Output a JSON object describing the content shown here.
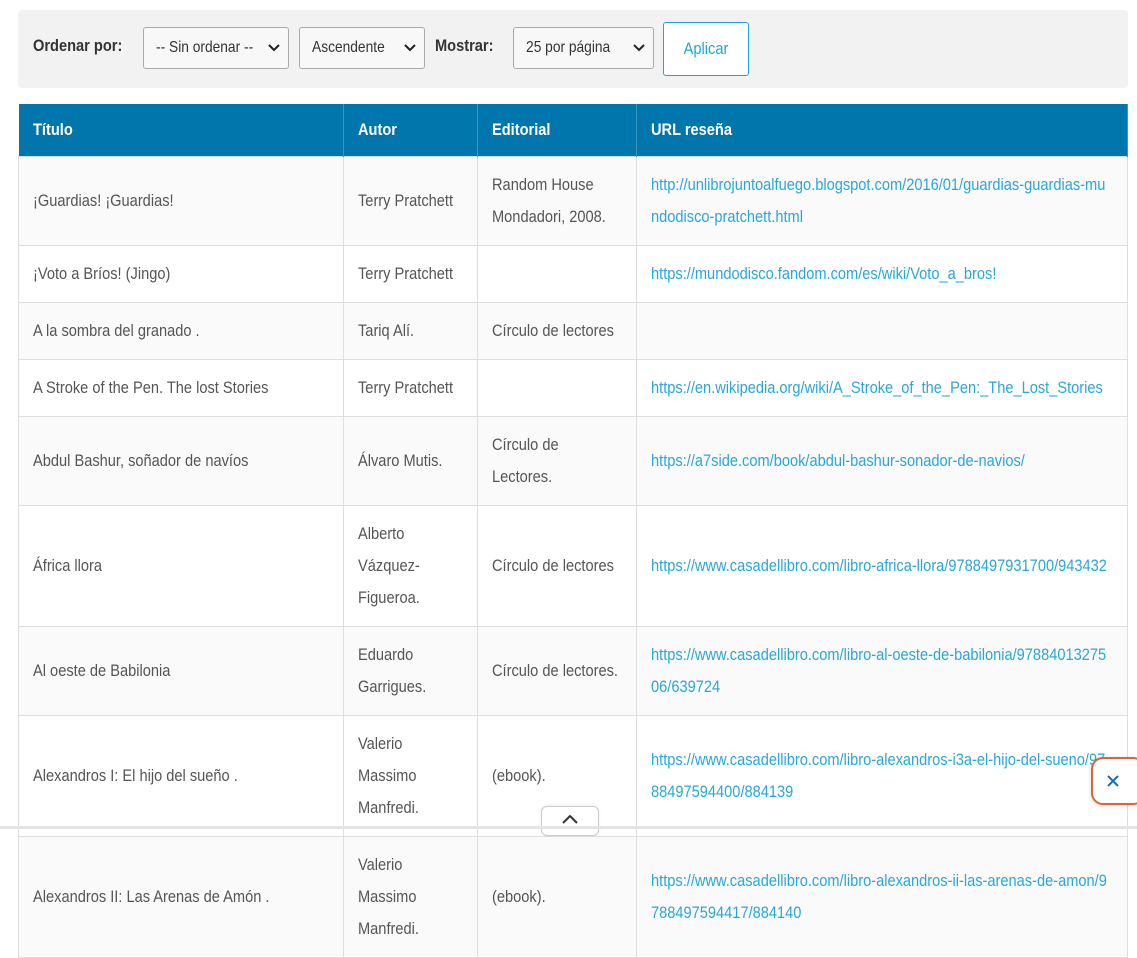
{
  "toolbar": {
    "sort_label": "Ordenar por:",
    "sort_value": "-- Sin ordenar --",
    "order_value": "Ascendente",
    "show_label": "Mostrar:",
    "show_value": "25 por página",
    "apply_label": "Aplicar"
  },
  "table": {
    "headers": [
      "Título",
      "Autor",
      "Editorial",
      "URL reseña"
    ],
    "rows": [
      {
        "titulo": "¡Guardias! ¡Guardias!",
        "autor": "Terry Pratchett",
        "editorial": "Random House Mondadori, 2008.",
        "url": "http://unlibrojuntoalfuego.blogspot.com/2016/01/guardias-guardias-mundodisco-pratchett.html"
      },
      {
        "titulo": "¡Voto a Bríos! (Jingo)",
        "autor": "Terry Pratchett",
        "editorial": "",
        "url": "https://mundodisco.fandom.com/es/wiki/Voto_a_bros!"
      },
      {
        "titulo": "A la sombra del granado .",
        "autor": "Tariq Alí.",
        "editorial": "Círculo de lectores",
        "url": ""
      },
      {
        "titulo": "A Stroke of the Pen. The lost Stories",
        "autor": "Terry Pratchett",
        "editorial": "",
        "url": "https://en.wikipedia.org/wiki/A_Stroke_of_the_Pen:_The_Lost_Stories"
      },
      {
        "titulo": "Abdul Bashur, soñador de navíos",
        "autor": "Álvaro Mutis.",
        "editorial": "Círculo de Lectores.",
        "url": "https://a7side.com/book/abdul-bashur-sonador-de-navios/"
      },
      {
        "titulo": "África llora",
        "autor": "Alberto Vázquez-Figueroa.",
        "editorial": "Círculo de lectores",
        "url": "https://www.casadellibro.com/libro-africa-llora/9788497931700/943432"
      },
      {
        "titulo": "Al oeste de Babilonia",
        "autor": "Eduardo Garrigues.",
        "editorial": "Círculo de lectores.",
        "url": "https://www.casadellibro.com/libro-al-oeste-de-babilonia/9788401327506/639724"
      },
      {
        "titulo": "Alexandros I: El hijo del sueño .",
        "autor": "Valerio Massimo Manfredi.",
        "editorial": "(ebook).",
        "url": "https://www.casadellibro.com/libro-alexandros-i3a-el-hijo-del-sueno/9788497594400/884139"
      },
      {
        "titulo": "Alexandros II: Las Arenas de Amón .",
        "autor": "Valerio Massimo Manfredi.",
        "editorial": "(ebook).",
        "url": "https://www.casadellibro.com/libro-alexandros-ii-las-arenas-de-amon/9788497594417/884140"
      }
    ]
  },
  "icons": {
    "close": "close-icon",
    "scroll_top": "chevron-up-icon",
    "dropdown": "chevron-down-icon"
  },
  "colors": {
    "header_bg": "#0076ad",
    "link": "#2aa7d8",
    "close_border": "#d9643f"
  }
}
